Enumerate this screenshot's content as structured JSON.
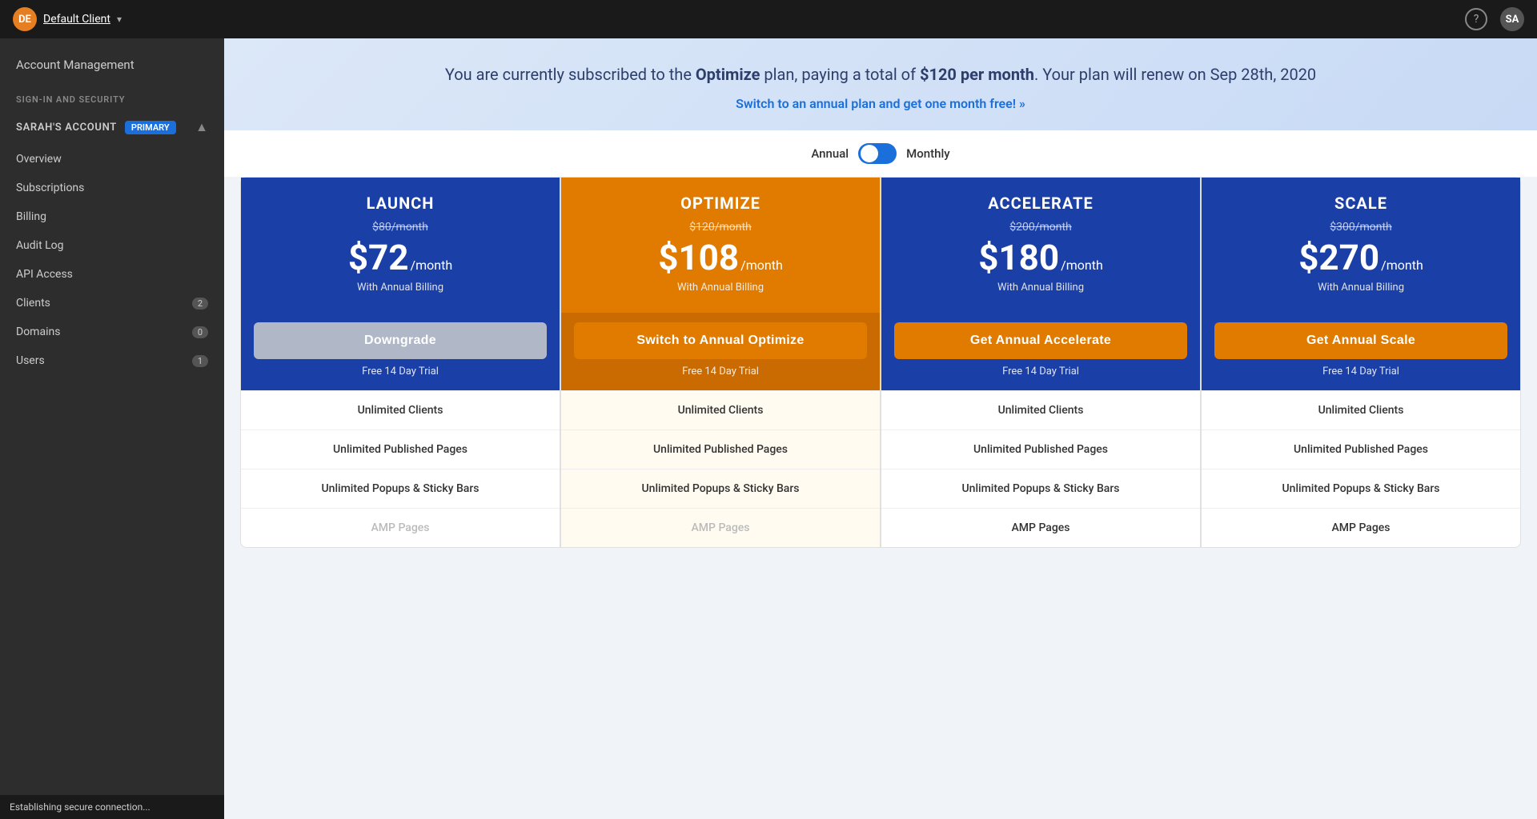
{
  "topNav": {
    "userInitials": "DE",
    "clientName": "Default Client",
    "helpLabel": "?",
    "userAvatarInitials": "SA"
  },
  "sidebar": {
    "accountManagementLabel": "Account Management",
    "groups": [
      {
        "title": "SIGN-IN AND SECURITY",
        "items": []
      }
    ],
    "sarahsAccount": {
      "label": "SARAH'S ACCOUNT",
      "badge": "PRIMARY"
    },
    "navItems": [
      {
        "label": "Overview",
        "badge": null
      },
      {
        "label": "Subscriptions",
        "badge": null
      },
      {
        "label": "Billing",
        "badge": null
      },
      {
        "label": "Audit Log",
        "badge": null
      },
      {
        "label": "API Access",
        "badge": null
      },
      {
        "label": "Clients",
        "badge": "2"
      },
      {
        "label": "Domains",
        "badge": "0"
      },
      {
        "label": "Users",
        "badge": "1"
      }
    ],
    "statusBar": "Establishing secure connection..."
  },
  "content": {
    "banner": {
      "line1": "You are currently subscribed to the ",
      "planName": "Optimize",
      "line2": " plan, paying a total of ",
      "price": "$120 per month",
      "line3": ". Your plan will renew on Sep 28th, 2020",
      "annualLink": "Switch to an annual plan and get one month free! »"
    },
    "toggle": {
      "annualLabel": "Annual",
      "monthlyLabel": "Monthly"
    },
    "plans": [
      {
        "id": "launch",
        "name": "LAUNCH",
        "headerType": "blue",
        "originalPrice": "$80/month",
        "price": "$72",
        "period": "/month",
        "billingNote": "With Annual Billing",
        "ctaLabel": "Downgrade",
        "ctaType": "gray",
        "freeTrialLabel": "Free 14 Day Trial",
        "features": [
          {
            "label": "Unlimited Clients",
            "type": "normal"
          },
          {
            "label": "Unlimited Published Pages",
            "type": "normal"
          },
          {
            "label": "Unlimited Popups & Sticky Bars",
            "type": "normal"
          },
          {
            "label": "AMP Pages",
            "type": "dimmed"
          }
        ]
      },
      {
        "id": "optimize",
        "name": "OPTIMIZE",
        "headerType": "orange",
        "originalPrice": "$120/month",
        "price": "$108",
        "period": "/month",
        "billingNote": "With Annual Billing",
        "ctaLabel": "Switch to Annual Optimize",
        "ctaType": "orange",
        "freeTrialLabel": "Free 14 Day Trial",
        "features": [
          {
            "label": "Unlimited Clients",
            "type": "highlighted"
          },
          {
            "label": "Unlimited Published Pages",
            "type": "highlighted"
          },
          {
            "label": "Unlimited Popups & Sticky Bars",
            "type": "highlighted"
          },
          {
            "label": "AMP Pages",
            "type": "dimmed-highlighted"
          }
        ]
      },
      {
        "id": "accelerate",
        "name": "ACCELERATE",
        "headerType": "blue",
        "originalPrice": "$200/month",
        "price": "$180",
        "period": "/month",
        "billingNote": "With Annual Billing",
        "ctaLabel": "Get Annual Accelerate",
        "ctaType": "orange",
        "freeTrialLabel": "Free 14 Day Trial",
        "features": [
          {
            "label": "Unlimited Clients",
            "type": "normal"
          },
          {
            "label": "Unlimited Published Pages",
            "type": "normal"
          },
          {
            "label": "Unlimited Popups & Sticky Bars",
            "type": "normal"
          },
          {
            "label": "AMP Pages",
            "type": "normal"
          }
        ]
      },
      {
        "id": "scale",
        "name": "SCALE",
        "headerType": "blue",
        "originalPrice": "$300/month",
        "price": "$270",
        "period": "/month",
        "billingNote": "With Annual Billing",
        "ctaLabel": "Get Annual Scale",
        "ctaType": "orange",
        "freeTrialLabel": "Free 14 Day Trial",
        "features": [
          {
            "label": "Unlimited Clients",
            "type": "normal"
          },
          {
            "label": "Unlimited Published Pages",
            "type": "normal"
          },
          {
            "label": "Unlimited Popups & Sticky Bars",
            "type": "normal"
          },
          {
            "label": "AMP Pages",
            "type": "normal"
          }
        ]
      }
    ]
  }
}
